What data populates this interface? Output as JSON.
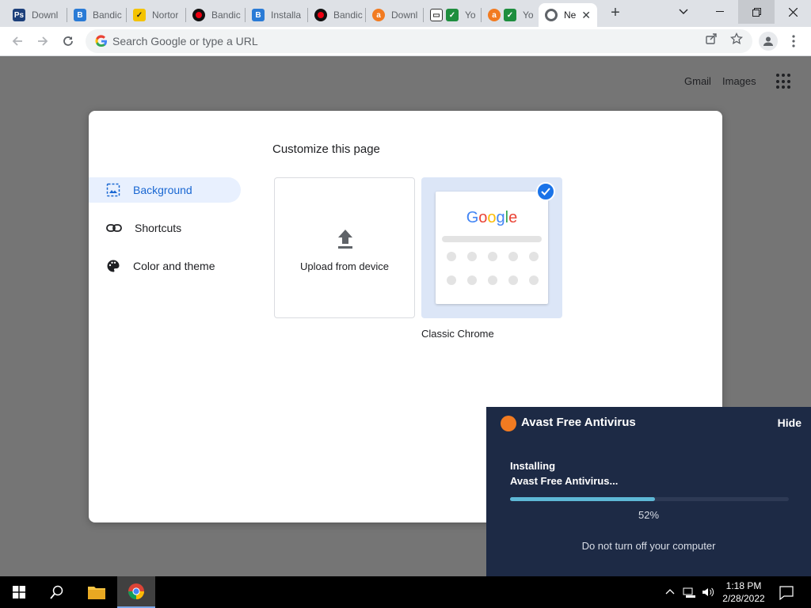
{
  "tabs": [
    {
      "title": "Downl",
      "icon": "photoscape-icon",
      "color": "#1c3f7a"
    },
    {
      "title": "Bandic",
      "icon": "bandicam-b-icon",
      "color": "#2a7bd6"
    },
    {
      "title": "Nortor",
      "icon": "norton-check-icon",
      "color": "#f4c300"
    },
    {
      "title": "Bandic",
      "icon": "bandicam-record-icon",
      "color": "#b00020"
    },
    {
      "title": "Installa",
      "icon": "bandicam-b-icon",
      "color": "#2a7bd6"
    },
    {
      "title": "Bandic",
      "icon": "bandicam-record-icon",
      "color": "#b00020"
    },
    {
      "title": "Downl",
      "icon": "avast-icon",
      "color": "#f27b21"
    },
    {
      "title": "Yo",
      "icon": "monitor-check-icon",
      "color": "#1e8e3e"
    },
    {
      "title": "Yo",
      "icon": "avast-check-icon",
      "color": "#f27b21"
    },
    {
      "title": "Ne",
      "icon": "chrome-icon",
      "color": "#5f6368"
    }
  ],
  "omnibox": {
    "placeholder": "Search Google or type a URL"
  },
  "ntp": {
    "gmail": "Gmail",
    "images": "Images"
  },
  "customize": {
    "title": "Customize this page",
    "menu": [
      {
        "label": "Background",
        "icon": "image-icon"
      },
      {
        "label": "Shortcuts",
        "icon": "link-icon"
      },
      {
        "label": "Color and theme",
        "icon": "palette-icon"
      }
    ],
    "upload_label": "Upload from device",
    "classic_label": "Classic Chrome",
    "google_logo": "Google"
  },
  "avast": {
    "title": "Avast Free Antivirus",
    "hide": "Hide",
    "status_line1": "Installing",
    "status_line2": "Avast Free Antivirus...",
    "progress": 0.52,
    "progress_text": "52%",
    "warning": "Do not turn off your computer"
  },
  "taskbar": {
    "time": "1:18 PM",
    "date": "2/28/2022"
  },
  "colors": {
    "accent": "#1a73e8",
    "avast_bg": "#1d2a45",
    "avast_progress": "#5eb8d6"
  }
}
